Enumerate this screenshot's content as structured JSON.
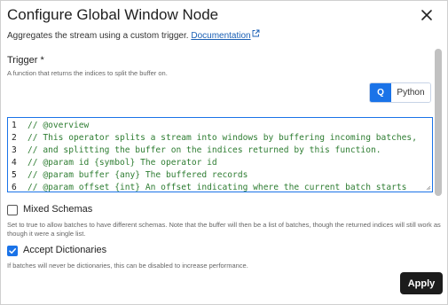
{
  "dialog": {
    "title": "Configure Global Window Node",
    "subtitle": "Aggregates the stream using a custom trigger.",
    "doc_link": "Documentation"
  },
  "trigger": {
    "label": "Trigger *",
    "description": "A function that returns the indices to split the buffer on.",
    "languages": {
      "selected": "Q",
      "other": "Python"
    },
    "code_lines": [
      {
        "num": "1",
        "text": "// @overview"
      },
      {
        "num": "2",
        "text": "// This operator splits a stream into windows by buffering incoming batches,"
      },
      {
        "num": "3",
        "text": "// and splitting the buffer on the indices returned by this function."
      },
      {
        "num": "4",
        "text": "// @param id {symbol} The operator id"
      },
      {
        "num": "5",
        "text": "// @param buffer {any} The buffered records"
      },
      {
        "num": "6",
        "text": "// @param offset {int} An offset indicating where the current batch starts"
      }
    ]
  },
  "mixed_schemas": {
    "label": "Mixed Schemas",
    "checked": false,
    "description": "Set to true to allow batches to have different schemas. Note that the buffer will then be a list of batches, though the returned indices will still work as though it were a single list."
  },
  "accept_dictionaries": {
    "label": "Accept Dictionaries",
    "checked": true,
    "description": "If batches will never be dictionaries, this can be disabled to increase performance."
  },
  "footer": {
    "apply_label": "Apply"
  },
  "colors": {
    "accent": "#1a73e8",
    "button_dark": "#1c1c1c",
    "code_comment": "#2e7d32"
  },
  "icons": {
    "close": "close-icon",
    "external": "external-link-icon",
    "check": "check-icon"
  }
}
